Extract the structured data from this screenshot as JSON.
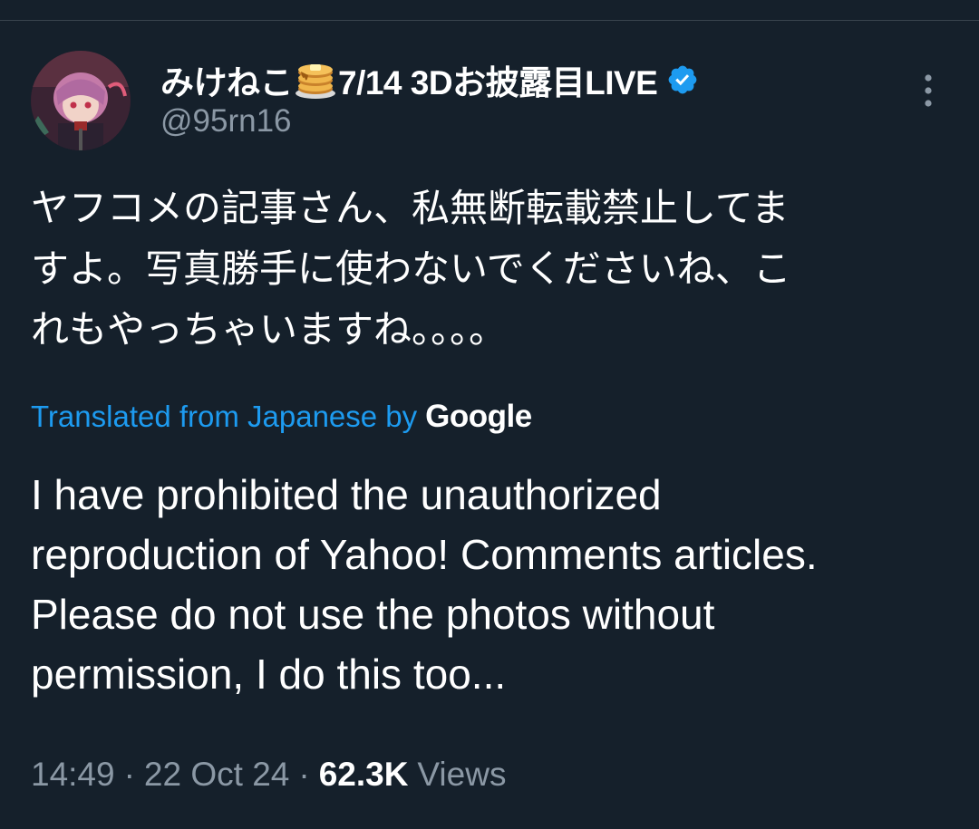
{
  "tweet": {
    "display_name_part1": "みけねこ",
    "display_name_part2": "7/14 3Dお披露目LIVE",
    "display_name_emoji": "pancakes",
    "handle": "@95rn16",
    "original_text": "ヤフコメの記事さん、私無断転載禁止してま\nすよ。写真勝手に使わないでくださいね、こ\nれもやっちゃいますね。。。。",
    "translated_label": "Translated from Japanese by",
    "translator": "Google",
    "translated_text": "I have prohibited the unauthorized\nreproduction of Yahoo! Comments articles.\nPlease do not use the photos without\npermission, I do this too...",
    "time": "14:49",
    "date": "22 Oct 24",
    "separator": "·",
    "views_count": "62.3K",
    "views_label": "Views"
  },
  "icons": {
    "verified": "verified-badge-icon",
    "more": "more-vertical-icon",
    "avatar": "avatar"
  },
  "colors": {
    "background": "#15202b",
    "link": "#1d9bf0",
    "secondary_text": "#8b98a5",
    "verified": "#1d9bf0"
  }
}
